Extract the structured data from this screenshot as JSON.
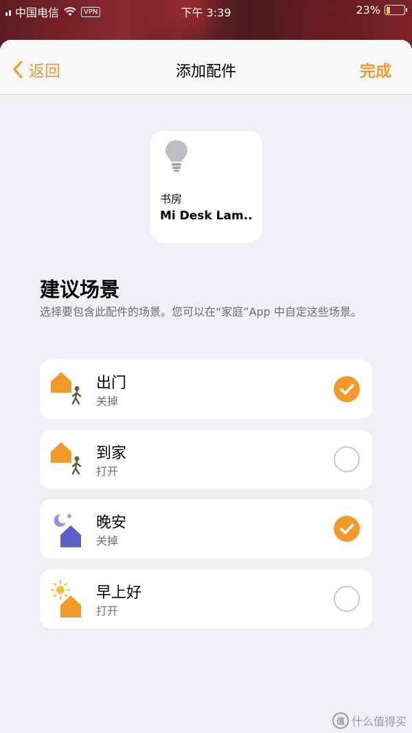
{
  "status_bar": {
    "carrier": "中国电信",
    "vpn": "VPN",
    "time": "下午 3:39",
    "battery": "23%",
    "battery_level": 0.23
  },
  "nav": {
    "back_label": "返回",
    "title": "添加配件",
    "done_label": "完成"
  },
  "accessory": {
    "room": "书房",
    "name": "Mi Desk Lam..."
  },
  "section": {
    "title": "建议场景",
    "description": "选择要包含此配件的场景。您可以在“家庭”App 中自定这些场景。"
  },
  "scenes": [
    {
      "name": "出门",
      "state": "关掉",
      "checked": true,
      "icon": "leave-home-icon"
    },
    {
      "name": "到家",
      "state": "打开",
      "checked": false,
      "icon": "arrive-home-icon"
    },
    {
      "name": "晚安",
      "state": "关掉",
      "checked": true,
      "icon": "good-night-icon"
    },
    {
      "name": "早上好",
      "state": "打开",
      "checked": false,
      "icon": "good-morning-icon"
    }
  ],
  "watermark": {
    "badge": "值",
    "text": "什么值得买"
  },
  "colors": {
    "accent": "#f09a2b",
    "night": "#5b5fc7"
  }
}
